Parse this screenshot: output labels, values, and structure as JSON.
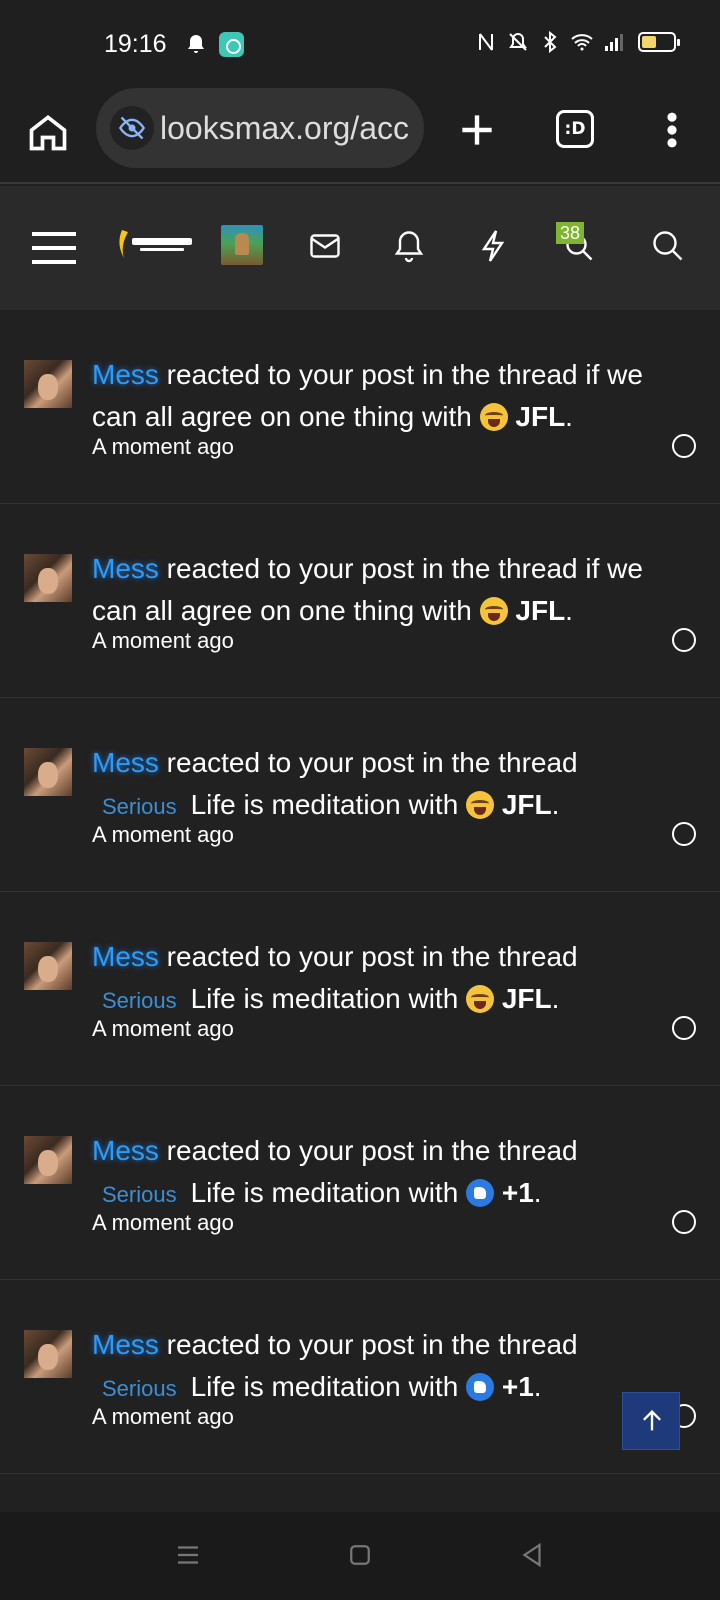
{
  "status_bar": {
    "time": "19:16"
  },
  "browser": {
    "url": "looksmax.org/acc",
    "tab_label": ":D"
  },
  "nav": {
    "badge_count": "38"
  },
  "notifications": [
    {
      "user": "Mess",
      "text": " reacted to your post in the thread if we can all agree on one thing with ",
      "prefix": "",
      "title": "",
      "reaction": "JFL",
      "emoji": "cry",
      "time": "A moment ago"
    },
    {
      "user": "Mess",
      "text": " reacted to your post in the thread if we can all agree on one thing with ",
      "prefix": "",
      "title": "",
      "reaction": "JFL",
      "emoji": "cry",
      "time": "A moment ago"
    },
    {
      "user": "Mess",
      "text": " reacted to your post in the thread",
      "prefix": "Serious",
      "title": "Life is meditation with ",
      "reaction": "JFL",
      "emoji": "cry",
      "time": "A moment ago"
    },
    {
      "user": "Mess",
      "text": " reacted to your post in the thread",
      "prefix": "Serious",
      "title": "Life is meditation with ",
      "reaction": "JFL",
      "emoji": "cry",
      "time": "A moment ago"
    },
    {
      "user": "Mess",
      "text": " reacted to your post in the thread",
      "prefix": "Serious",
      "title": "Life is meditation with ",
      "reaction": "+1",
      "emoji": "like",
      "time": "A moment ago"
    },
    {
      "user": "Mess",
      "text": " reacted to your post in the thread",
      "prefix": "Serious",
      "title": "Life is meditation with ",
      "reaction": "+1",
      "emoji": "like",
      "time": "A moment ago"
    }
  ]
}
